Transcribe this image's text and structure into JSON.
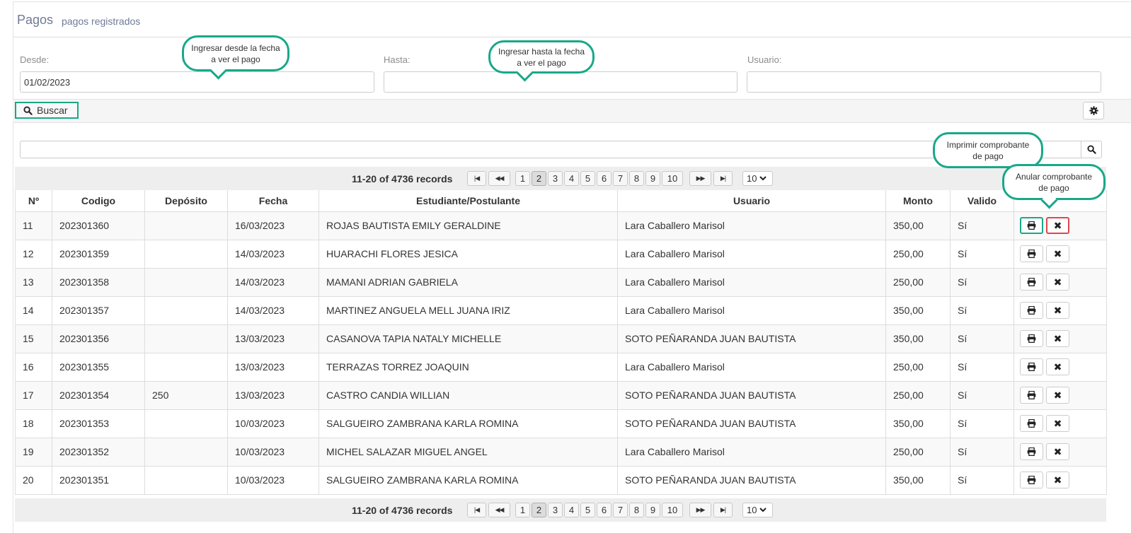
{
  "header": {
    "title": "Pagos",
    "subtitle": "pagos registrados"
  },
  "filters": {
    "desde_label": "Desde:",
    "desde_value": "01/02/2023",
    "hasta_label": "Hasta:",
    "hasta_value": "",
    "usuario_label": "Usuario:",
    "usuario_value": ""
  },
  "toolbar": {
    "search_label": "Buscar"
  },
  "pager": {
    "records_text": "11-20 of 4736 records",
    "pages": [
      "1",
      "2",
      "3",
      "4",
      "5",
      "6",
      "7",
      "8",
      "9",
      "10"
    ],
    "current_page": "2",
    "page_size": "10"
  },
  "table": {
    "columns": [
      "Nº",
      "Codigo",
      "Depósito",
      "Fecha",
      "Estudiante/Postulante",
      "Usuario",
      "Monto",
      "Valido",
      ""
    ],
    "rows": [
      {
        "n": "11",
        "codigo": "202301360",
        "deposito": "",
        "fecha": "16/03/2023",
        "estudiante": "ROJAS BAUTISTA EMILY GERALDINE",
        "usuario": "Lara Caballero Marisol",
        "monto": "350,00",
        "valido": "Sí"
      },
      {
        "n": "12",
        "codigo": "202301359",
        "deposito": "",
        "fecha": "14/03/2023",
        "estudiante": "HUARACHI FLORES JESICA",
        "usuario": "Lara Caballero Marisol",
        "monto": "250,00",
        "valido": "Sí"
      },
      {
        "n": "13",
        "codigo": "202301358",
        "deposito": "",
        "fecha": "14/03/2023",
        "estudiante": "MAMANI ADRIAN GABRIELA",
        "usuario": "Lara Caballero Marisol",
        "monto": "250,00",
        "valido": "Sí"
      },
      {
        "n": "14",
        "codigo": "202301357",
        "deposito": "",
        "fecha": "14/03/2023",
        "estudiante": "MARTINEZ ANGUELA MELL JUANA IRIZ",
        "usuario": "Lara Caballero Marisol",
        "monto": "350,00",
        "valido": "Sí"
      },
      {
        "n": "15",
        "codigo": "202301356",
        "deposito": "",
        "fecha": "13/03/2023",
        "estudiante": "CASANOVA TAPIA NATALY MICHELLE",
        "usuario": "SOTO PEÑARANDA JUAN BAUTISTA",
        "monto": "350,00",
        "valido": "Sí"
      },
      {
        "n": "16",
        "codigo": "202301355",
        "deposito": "",
        "fecha": "13/03/2023",
        "estudiante": "TERRAZAS TORREZ JOAQUIN",
        "usuario": "Lara Caballero Marisol",
        "monto": "250,00",
        "valido": "Sí"
      },
      {
        "n": "17",
        "codigo": "202301354",
        "deposito": "250",
        "fecha": "13/03/2023",
        "estudiante": "CASTRO CANDIA WILLIAN",
        "usuario": "SOTO PEÑARANDA JUAN BAUTISTA",
        "monto": "250,00",
        "valido": "Sí"
      },
      {
        "n": "18",
        "codigo": "202301353",
        "deposito": "",
        "fecha": "10/03/2023",
        "estudiante": "SALGUEIRO ZAMBRANA KARLA ROMINA",
        "usuario": "SOTO PEÑARANDA JUAN BAUTISTA",
        "monto": "350,00",
        "valido": "Sí"
      },
      {
        "n": "19",
        "codigo": "202301352",
        "deposito": "",
        "fecha": "10/03/2023",
        "estudiante": "MICHEL SALAZAR MIGUEL ANGEL",
        "usuario": "Lara Caballero Marisol",
        "monto": "250,00",
        "valido": "Sí"
      },
      {
        "n": "20",
        "codigo": "202301351",
        "deposito": "",
        "fecha": "10/03/2023",
        "estudiante": "SALGUEIRO ZAMBRANA KARLA ROMINA",
        "usuario": "SOTO PEÑARANDA JUAN BAUTISTA",
        "monto": "350,00",
        "valido": "Sí"
      }
    ]
  },
  "callouts": {
    "desde": "Ingresar desde la fecha  a ver el pago",
    "hasta": "Ingresar hasta la fecha  a ver el pago",
    "imprimir": "Imprimir comprobante de pago",
    "anular": "Anular comprobante de pago"
  },
  "icons": {
    "search": "search-icon",
    "settings": "gear-icon",
    "print": "print-icon",
    "delete": "close-icon",
    "first": "first-page-icon",
    "prev": "prev-page-icon",
    "next": "next-page-icon",
    "last": "last-page-icon"
  },
  "colors": {
    "highlight_green": "#18a889",
    "highlight_red": "#e0454f",
    "title": "#6f7a95"
  }
}
